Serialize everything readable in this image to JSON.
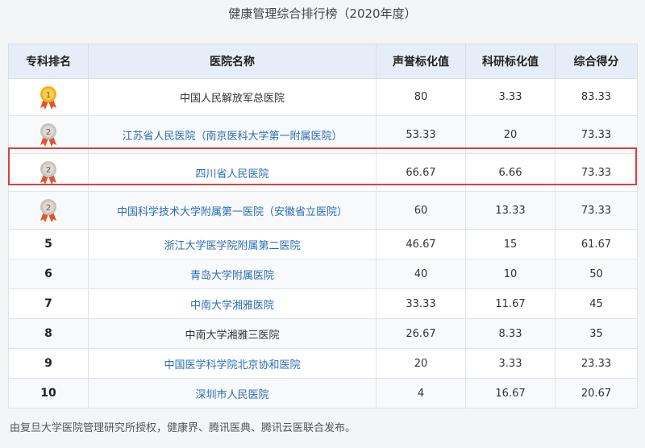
{
  "title": "健康管理综合排行榜（2020年度）",
  "headers": [
    "专科排名",
    "医院名称",
    "声誉标化值",
    "科研标化值",
    "综合得分"
  ],
  "rows": [
    {
      "rank": "1",
      "medal": "gold",
      "name": "中国人民解放军总医院",
      "link": false,
      "reputation": "80",
      "research": "3.33",
      "score": "83.33"
    },
    {
      "rank": "2",
      "medal": "silver",
      "name": "江苏省人民医院（南京医科大学第一附属医院）",
      "link": true,
      "reputation": "53.33",
      "research": "20",
      "score": "73.33"
    },
    {
      "rank": "2",
      "medal": "silver",
      "name": "四川省人民医院",
      "link": true,
      "reputation": "66.67",
      "research": "6.66",
      "score": "73.33"
    },
    {
      "rank": "2",
      "medal": "silver",
      "name": "中国科学技术大学附属第一医院（安徽省立医院）",
      "link": true,
      "reputation": "60",
      "research": "13.33",
      "score": "73.33"
    },
    {
      "rank": "5",
      "medal": null,
      "name": "浙江大学医学院附属第二医院",
      "link": true,
      "reputation": "46.67",
      "research": "15",
      "score": "61.67"
    },
    {
      "rank": "6",
      "medal": null,
      "name": "青岛大学附属医院",
      "link": true,
      "reputation": "40",
      "research": "10",
      "score": "50"
    },
    {
      "rank": "7",
      "medal": null,
      "name": "中南大学湘雅医院",
      "link": true,
      "reputation": "33.33",
      "research": "11.67",
      "score": "45"
    },
    {
      "rank": "8",
      "medal": null,
      "name": "中南大学湘雅三医院",
      "link": false,
      "reputation": "26.67",
      "research": "8.33",
      "score": "35"
    },
    {
      "rank": "9",
      "medal": null,
      "name": "中国医学科学院北京协和医院",
      "link": true,
      "reputation": "20",
      "research": "3.33",
      "score": "23.33"
    },
    {
      "rank": "10",
      "medal": null,
      "name": "深圳市人民医院",
      "link": true,
      "reputation": "4",
      "research": "16.67",
      "score": "20.67"
    }
  ],
  "highlighted_row": 2,
  "footer": "由复旦大学医院管理研究所授权，健康界、腾讯医典、腾讯云医联合发布。",
  "colors": {
    "link": "#2a6eb5",
    "header_bg": "#e5eef8",
    "highlight": "#d9403a",
    "gold": "#f2b21b",
    "silver": "#c9c3bf",
    "ribbon": "#e0552d"
  }
}
